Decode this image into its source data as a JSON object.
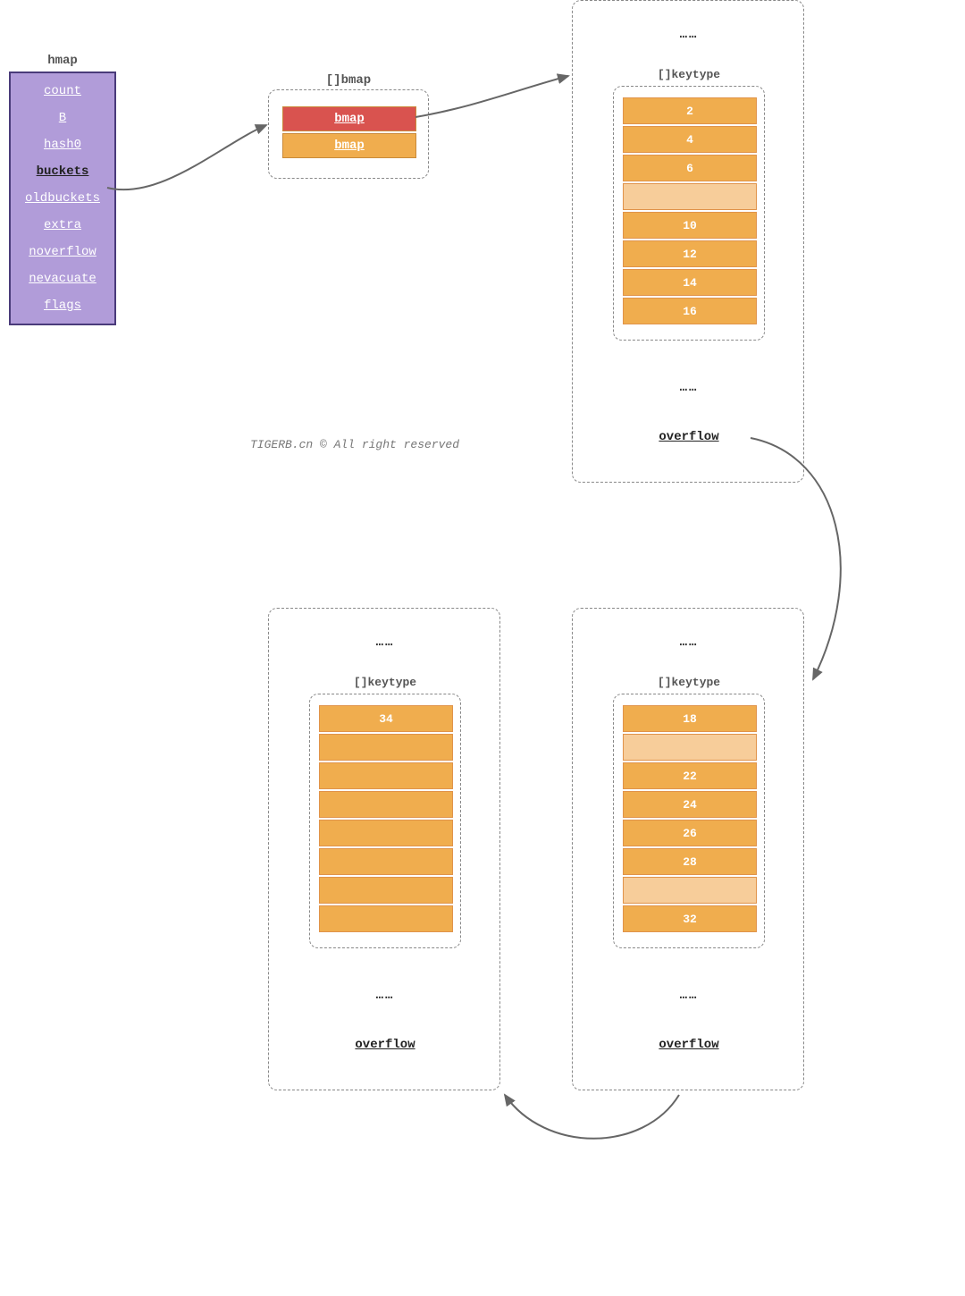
{
  "hmap": {
    "title": "hmap",
    "fields": [
      "count",
      "B",
      "hash0",
      "buckets",
      "oldbuckets",
      "extra",
      "noverflow",
      "nevacuate",
      "flags"
    ],
    "bold_index": 3
  },
  "bmap_array": {
    "title": "[]bmap",
    "rows": [
      "bmap",
      "bmap"
    ]
  },
  "bucket1": {
    "ellipsis_top": "……",
    "keytype_label": "[]keytype",
    "keys": [
      "2",
      "4",
      "6",
      "",
      "10",
      "12",
      "14",
      "16"
    ],
    "light_indices": [
      3
    ],
    "ellipsis_bottom": "……",
    "overflow": "overflow"
  },
  "bucket2": {
    "ellipsis_top": "……",
    "keytype_label": "[]keytype",
    "keys": [
      "18",
      "",
      "22",
      "24",
      "26",
      "28",
      "",
      "32"
    ],
    "light_indices": [
      1,
      6
    ],
    "ellipsis_bottom": "……",
    "overflow": "overflow"
  },
  "bucket3": {
    "ellipsis_top": "……",
    "keytype_label": "[]keytype",
    "keys": [
      "34",
      "",
      "",
      "",
      "",
      "",
      "",
      ""
    ],
    "light_indices": [],
    "ellipsis_bottom": "……",
    "overflow": "overflow"
  },
  "watermark": "TIGERB.cn © All right reserved"
}
